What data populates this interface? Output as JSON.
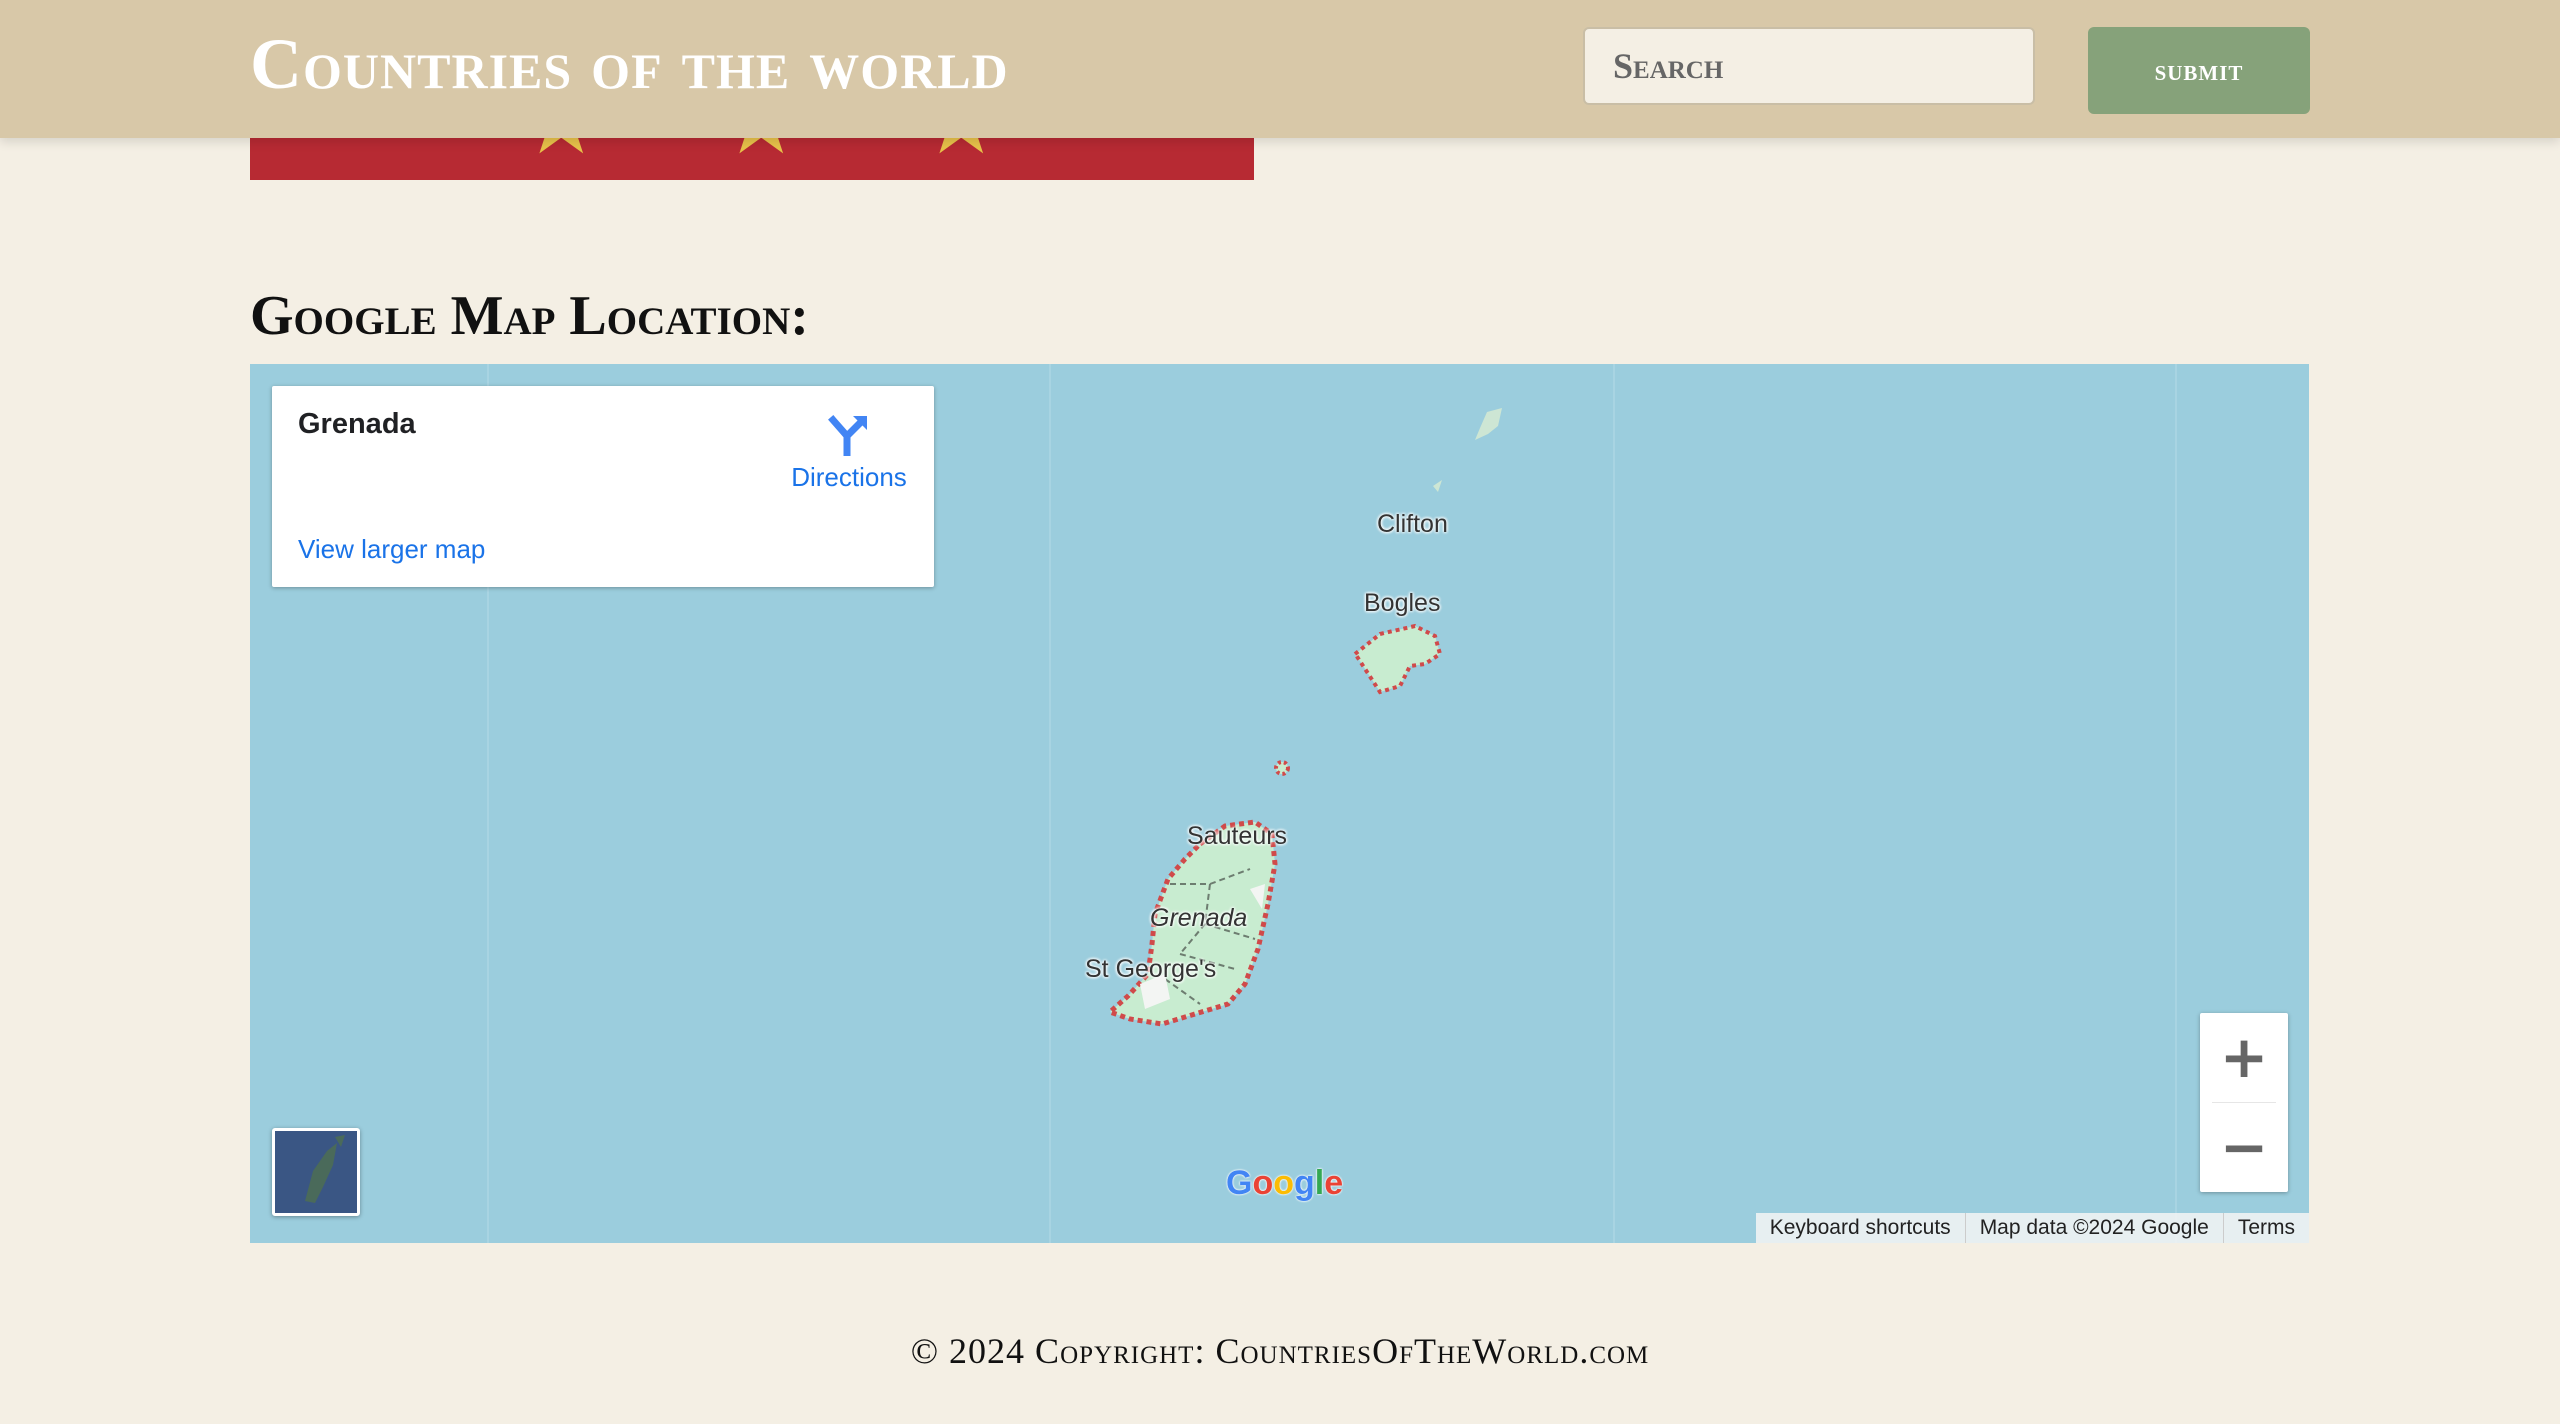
{
  "header": {
    "site_title": "Countries of the world",
    "search_placeholder": "Search",
    "submit_label": "submit"
  },
  "flag": {
    "stripe_color": "#b72a33",
    "star_color": "#e8c24a",
    "star_glyph": "★"
  },
  "map_section": {
    "heading": "Google Map Location:"
  },
  "map": {
    "card": {
      "place_name": "Grenada",
      "directions_label": "Directions",
      "larger_map_label": "View larger map"
    },
    "labels": {
      "clifton": "Clifton",
      "bogles": "Bogles",
      "sauteurs": "Sauteurs",
      "grenada": "Grenada",
      "st_georges": "St George's"
    },
    "zoom_in": "+",
    "zoom_out": "−",
    "google_logo": {
      "g1": "G",
      "o1": "o",
      "o2": "o",
      "g2": "g",
      "l": "l",
      "e": "e"
    },
    "attribution": {
      "keyboard": "Keyboard shortcuts",
      "map_data": "Map data ©2024 Google",
      "terms": "Terms"
    },
    "colors": {
      "water": "#9bcddd",
      "land": "#c8ecd0",
      "border": "#d04a4a",
      "link": "#1a73e8"
    }
  },
  "footer": {
    "copyright": "© 2024 Copyright: CountriesOfTheWorld.com"
  },
  "colors": {
    "header_bg": "#d8c8a8",
    "page_bg": "#f4efe4",
    "submit_bg": "#86a27a"
  }
}
